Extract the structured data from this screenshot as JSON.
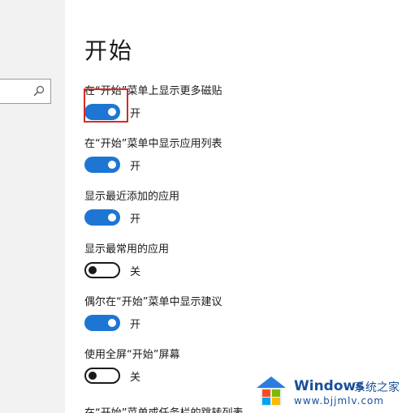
{
  "search": {
    "placeholder": "",
    "icon": "search-icon"
  },
  "page": {
    "title": "开始"
  },
  "settings": [
    {
      "label": "在“开始”菜单上显示更多磁贴",
      "on": true,
      "state_text": "开"
    },
    {
      "label": "在“开始”菜单中显示应用列表",
      "on": true,
      "state_text": "开"
    },
    {
      "label": "显示最近添加的应用",
      "on": true,
      "state_text": "开"
    },
    {
      "label": "显示最常用的应用",
      "on": false,
      "state_text": "关"
    },
    {
      "label": "偶尔在“开始”菜单中显示建议",
      "on": true,
      "state_text": "开"
    },
    {
      "label": "使用全屏“开始”屏幕",
      "on": false,
      "state_text": "关"
    }
  ],
  "cut_off_setting": {
    "label": "在“开始”菜单或任务栏的跳转列表"
  },
  "colors": {
    "toggle_on": "#1d76d3",
    "highlight": "#d42a2a",
    "watermark_text": "#1a4f9a"
  },
  "watermark": {
    "brand": "Windows",
    "site": "系统之家",
    "url": "www.bjjmlv.com"
  }
}
